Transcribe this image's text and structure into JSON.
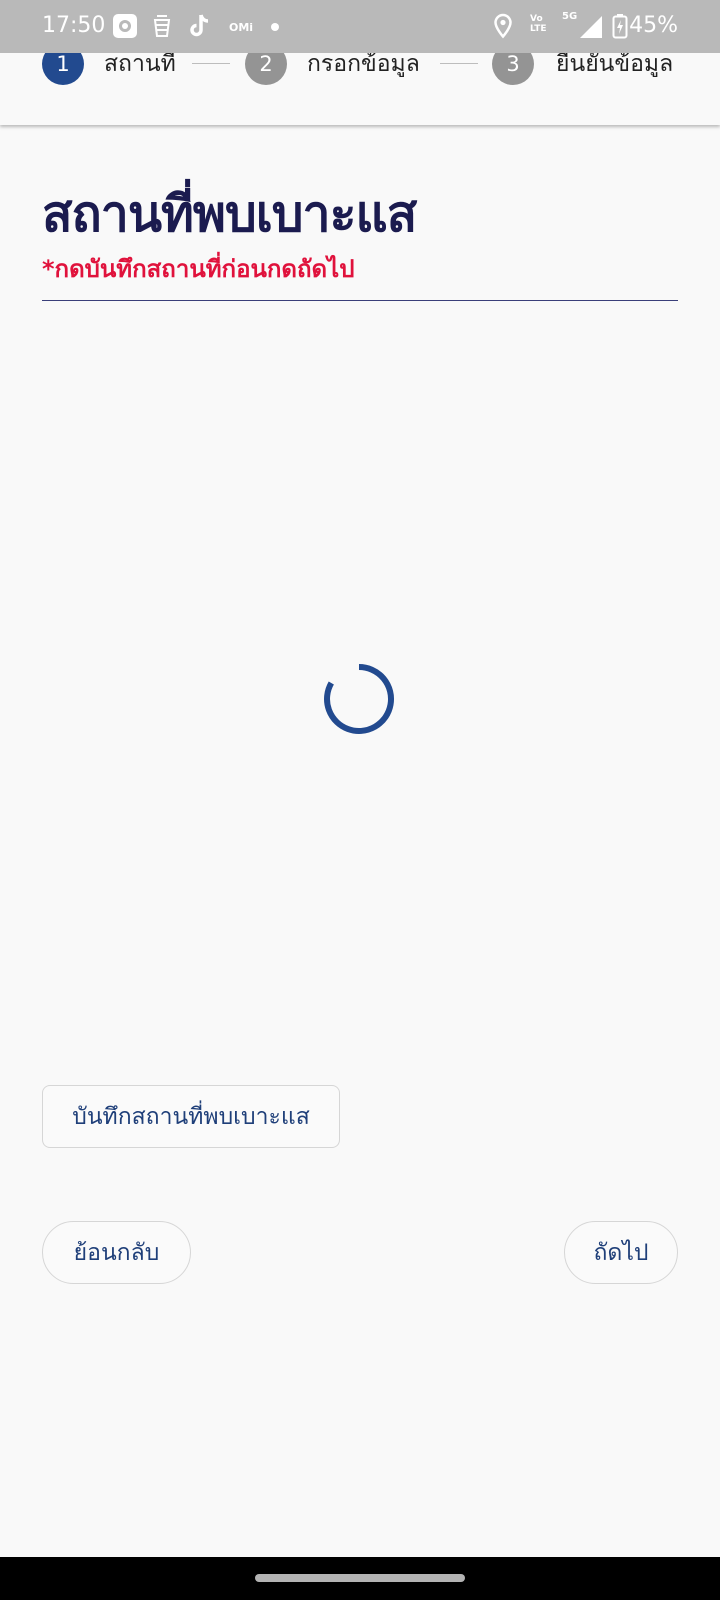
{
  "status_bar": {
    "time": "17:50",
    "network_label": "5G",
    "volte_label": "Vo LTE",
    "battery": "45%",
    "app_icons": [
      "screen-record-icon",
      "bucket-app-icon",
      "tiktok-icon",
      "omi-app-icon",
      "dot-icon"
    ],
    "system_icons": [
      "location-icon",
      "volte-icon",
      "signal-icon",
      "battery-charging-icon"
    ]
  },
  "stepper": {
    "steps": [
      {
        "number": "1",
        "label": "สถานที่",
        "active": true
      },
      {
        "number": "2",
        "label": "กรอกข้อมูล",
        "active": false
      },
      {
        "number": "3",
        "label": "ยืนยันข้อมูล",
        "active": false
      }
    ],
    "colors": {
      "active": "#224a8f",
      "inactive": "#949494"
    }
  },
  "main": {
    "title": "สถานที่พบเบาะแส",
    "note": "*กดบันทึกสถานที่ก่อนกดถัดไป",
    "loading_indicator": "spinner-icon",
    "save_location_button": "บันทึกสถานที่พบเบาะแส",
    "back_button": "ย้อนกลับ",
    "next_button": "ถัดไป"
  },
  "colors": {
    "title": "#1b1b4f",
    "note": "#e0123c",
    "accent": "#224a8f",
    "button_text": "#1f3f79",
    "background": "#f9f9f9"
  }
}
